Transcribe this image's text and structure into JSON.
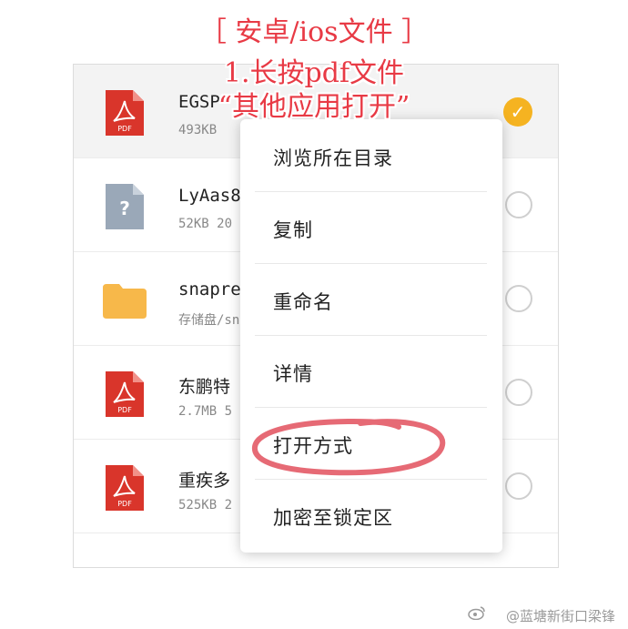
{
  "overlay": {
    "line1": "［ 安卓/ios文件 ］",
    "line2": "1.长按pdf文件",
    "line3": "“其他应用打开”"
  },
  "files": [
    {
      "name": "EGSP",
      "meta": "493KB",
      "icon": "pdf",
      "selected": true
    },
    {
      "name": "LyAas8",
      "meta": "52KB  20",
      "icon": "unknown",
      "selected": false
    },
    {
      "name": "snaprea",
      "meta": "存储盘/sn",
      "icon": "folder",
      "selected": false
    },
    {
      "name": "东鹏特",
      "meta": "2.7MB  5",
      "icon": "pdf",
      "selected": false
    },
    {
      "name": "重疾多",
      "meta": "525KB  2",
      "icon": "pdf",
      "selected": false
    }
  ],
  "pdf_badge": "PDF",
  "context_menu": {
    "items": [
      {
        "label": "浏览所在目录"
      },
      {
        "label": "复制"
      },
      {
        "label": "重命名"
      },
      {
        "label": "详情"
      },
      {
        "label": "打开方式",
        "highlighted": true
      },
      {
        "label": "加密至锁定区"
      }
    ]
  },
  "watermark": "@蓝塘新街口梁锋",
  "colors": {
    "accent": "#f5b321",
    "annotation": "#e83a45",
    "pdf_red": "#d9352b",
    "folder": "#f7b84a"
  }
}
